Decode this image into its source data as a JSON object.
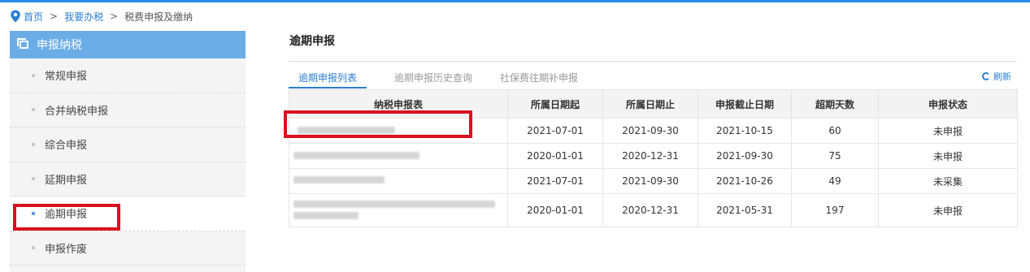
{
  "breadcrumb": {
    "home": "首页",
    "level2": "我要办税",
    "current": "税费申报及缴纳",
    "sep1": ">",
    "sep2": ">"
  },
  "sidebar": {
    "header": "申报纳税",
    "items": [
      {
        "label": "常规申报"
      },
      {
        "label": "合并纳税申报"
      },
      {
        "label": "综合申报"
      },
      {
        "label": "延期申报"
      },
      {
        "label": "逾期申报"
      },
      {
        "label": "申报作废"
      }
    ],
    "active_index": 4
  },
  "main": {
    "title": "逾期申报",
    "tabs": [
      {
        "label": "逾期申报列表"
      },
      {
        "label": "逾期申报历史查询"
      },
      {
        "label": "社保费往期补申报"
      }
    ],
    "refresh_label": "刷新"
  },
  "table": {
    "headers": [
      "纳税申报表",
      "所属日期起",
      "所属日期止",
      "申报截止日期",
      "超期天数",
      "申报状态"
    ],
    "rows": [
      {
        "name": "",
        "start": "2021-07-01",
        "end": "2021-09-30",
        "deadline": "2021-10-15",
        "days": "60",
        "status": "未申报"
      },
      {
        "name": "",
        "start": "2020-01-01",
        "end": "2020-12-31",
        "deadline": "2021-09-30",
        "days": "75",
        "status": "未申报"
      },
      {
        "name": "",
        "start": "2021-07-01",
        "end": "2021-09-30",
        "deadline": "2021-10-26",
        "days": "49",
        "status": "未采集"
      },
      {
        "name": "",
        "start": "2020-01-01",
        "end": "2020-12-31",
        "deadline": "2021-05-31",
        "days": "197",
        "status": "未申报"
      }
    ]
  },
  "colors": {
    "accent": "#2a7fd4",
    "sidebar_header": "#6aade6",
    "highlight_red": "#d9101e"
  }
}
